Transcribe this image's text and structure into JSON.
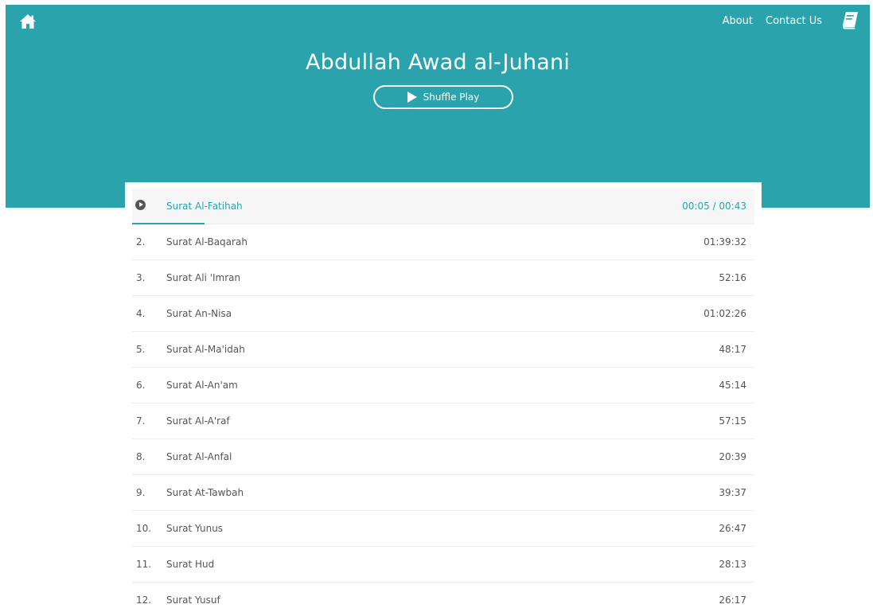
{
  "nav": {
    "home_icon": "home-icon",
    "links": [
      "About",
      "Contact Us"
    ],
    "book_icon": "book-icon"
  },
  "header": {
    "title": "Abdullah Awad al-Juhani",
    "shuffle_label": "Shuffle Play"
  },
  "colors": {
    "accent": "#2ba3ad",
    "text": "#555555",
    "row_divider": "#ececec",
    "active_row_bg": "#f6f6f6"
  },
  "player": {
    "now_playing": "Surat Al-Fatihah",
    "time": "00:05 / 00:43",
    "progress_fraction": 0.116
  },
  "tracks": [
    {
      "num": "",
      "name": "Surat Al-Fatihah",
      "duration": "00:05 / 00:43",
      "active": true
    },
    {
      "num": "2.",
      "name": "Surat Al-Baqarah",
      "duration": "01:39:32"
    },
    {
      "num": "3.",
      "name": "Surat Ali 'Imran",
      "duration": "52:16"
    },
    {
      "num": "4.",
      "name": "Surat An-Nisa",
      "duration": "01:02:26"
    },
    {
      "num": "5.",
      "name": "Surat Al-Ma'idah",
      "duration": "48:17"
    },
    {
      "num": "6.",
      "name": "Surat Al-An'am",
      "duration": "45:14"
    },
    {
      "num": "7.",
      "name": "Surat Al-A'raf",
      "duration": "57:15"
    },
    {
      "num": "8.",
      "name": "Surat Al-Anfal",
      "duration": "20:39"
    },
    {
      "num": "9.",
      "name": "Surat At-Tawbah",
      "duration": "39:37"
    },
    {
      "num": "10.",
      "name": "Surat Yunus",
      "duration": "26:47"
    },
    {
      "num": "11.",
      "name": "Surat Hud",
      "duration": "28:13"
    },
    {
      "num": "12.",
      "name": "Surat Yusuf",
      "duration": "26:17"
    }
  ]
}
